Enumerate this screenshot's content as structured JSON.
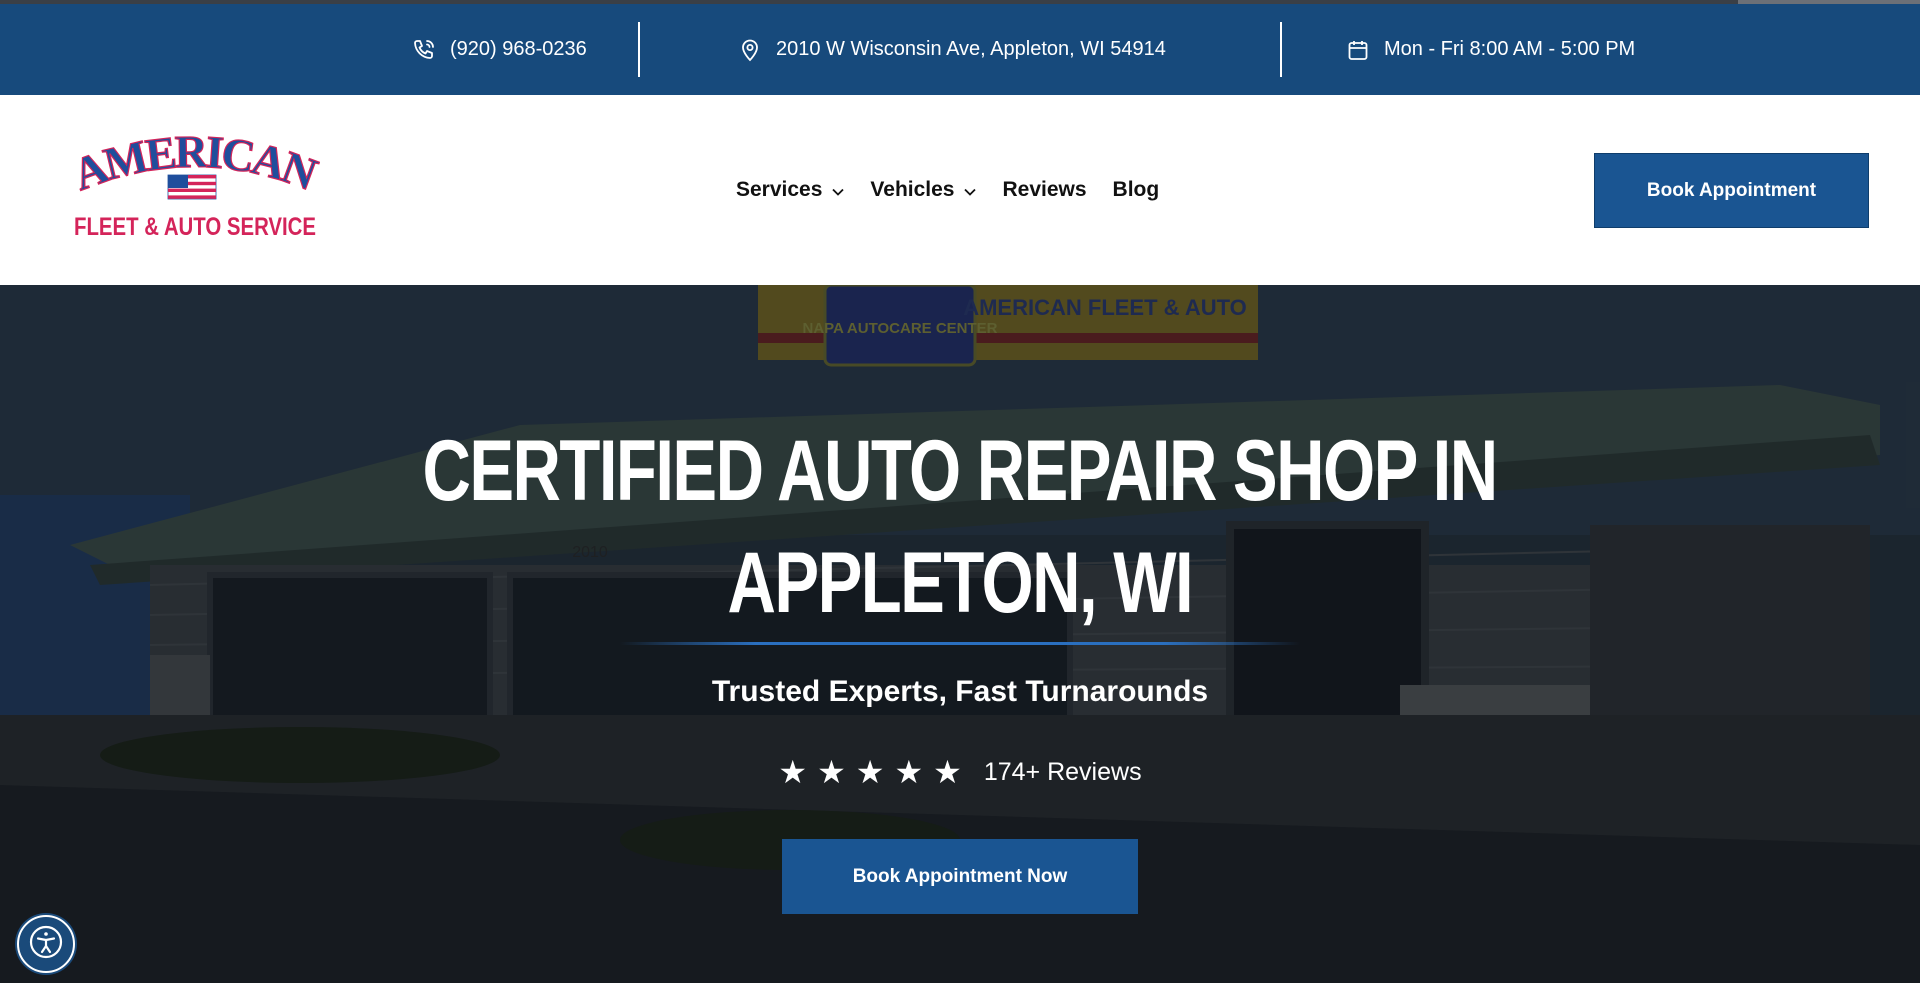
{
  "topbar": {
    "phone": "(920) 968-0236",
    "address": "2010 W Wisconsin Ave, Appleton, WI 54914",
    "hours": "Mon - Fri 8:00 AM - 5:00 PM"
  },
  "logo": {
    "line1": "AMERICAN",
    "line2": "FLEET & AUTO SERVICE"
  },
  "nav": {
    "items": [
      {
        "label": "Services",
        "has_dropdown": true
      },
      {
        "label": "Vehicles",
        "has_dropdown": true
      },
      {
        "label": "Reviews",
        "has_dropdown": false
      },
      {
        "label": "Blog",
        "has_dropdown": false
      }
    ]
  },
  "header": {
    "cta_label": "Book Appointment"
  },
  "hero": {
    "title_line1": "Certified Auto Repair Shop In",
    "title_line2": "Appleton, WI",
    "subtitle": "Trusted Experts, Fast Turnarounds",
    "rating_stars": 5,
    "reviews_text": "174+ Reviews",
    "cta_label": "Book Appointment Now",
    "sign_text": "AMERICAN FLEET & AUTO",
    "sign_badge": "NAPA AUTOCARE CENTER",
    "building_number": "2010"
  },
  "colors": {
    "topbar_bg": "#174a7c",
    "button_bg": "#1a5592",
    "logo_red": "#d4245a",
    "logo_blue": "#1f4e9c"
  },
  "icons": {
    "phone": "phone-icon",
    "location": "location-pin-icon",
    "calendar": "calendar-icon",
    "chevron": "chevron-down-icon",
    "star": "star-icon",
    "accessibility": "accessibility-icon"
  }
}
